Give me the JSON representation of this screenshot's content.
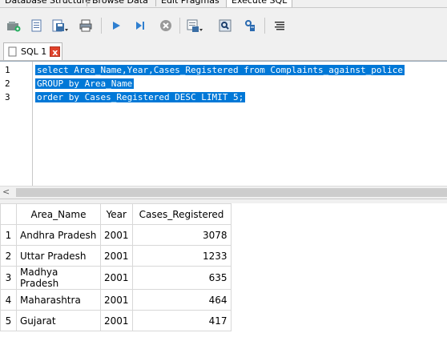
{
  "top_tabs": [
    "Database Structure",
    "Browse Data",
    "Edit Pragmas",
    "Execute SQL"
  ],
  "toolbar": {
    "buttons": [
      "open-tab-icon",
      "open-sql-file-icon",
      "save-sql-file-icon",
      "print-icon",
      "execute-all-icon",
      "execute-current-line-icon",
      "stop-icon",
      "save-results-icon",
      "find-icon",
      "find-replace-icon",
      "comment-icon"
    ]
  },
  "sql_tab": {
    "label": "SQL 1",
    "close": "x"
  },
  "editor": {
    "line_numbers": [
      "1",
      "2",
      "3"
    ],
    "lines": [
      "select Area_Name,Year,Cases_Registered from Complaints_against_police",
      "GROUP by Area_Name",
      "order by Cases_Registered DESC LIMIT 5;"
    ]
  },
  "scrollbar": {
    "left_arrow": "<"
  },
  "results": {
    "columns": [
      "Area_Name",
      "Year",
      "Cases_Registered"
    ],
    "rows": [
      {
        "n": "1",
        "area": "Andhra Pradesh",
        "year": "2001",
        "cases": "3078"
      },
      {
        "n": "2",
        "area": "Uttar Pradesh",
        "year": "2001",
        "cases": "1233"
      },
      {
        "n": "3",
        "area": "Madhya Pradesh",
        "year": "2001",
        "cases": "635"
      },
      {
        "n": "4",
        "area": "Maharashtra",
        "year": "2001",
        "cases": "464"
      },
      {
        "n": "5",
        "area": "Gujarat",
        "year": "2001",
        "cases": "417"
      }
    ]
  }
}
